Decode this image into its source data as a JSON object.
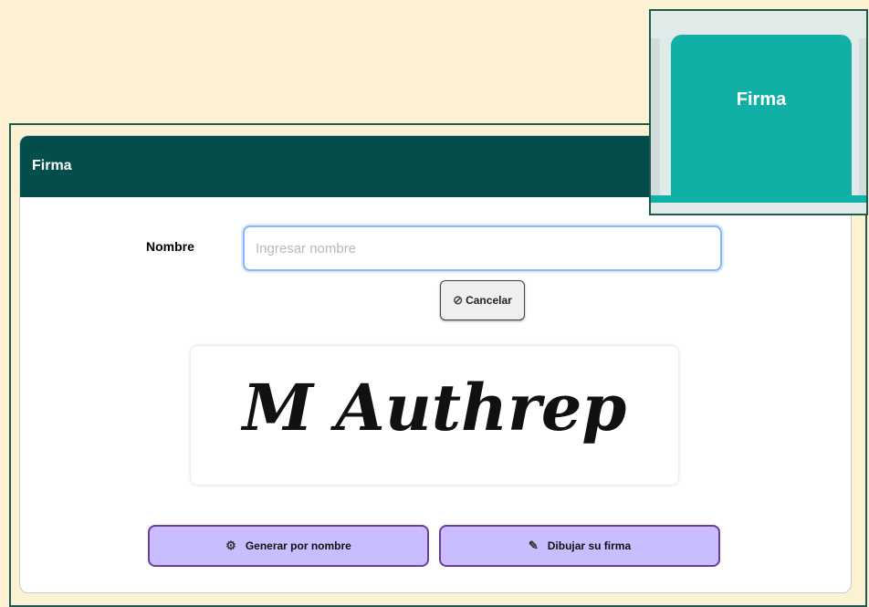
{
  "dialog": {
    "title": "Firma"
  },
  "form": {
    "name_label": "Nombre",
    "name_placeholder": "Ingresar nombre",
    "name_value": ""
  },
  "buttons": {
    "cancel_label": "Cancelar",
    "generate_label": "Generar por nombre",
    "draw_label": "Dibujar su firma"
  },
  "signature": {
    "text": "M Authrep"
  },
  "tab": {
    "label": "Firma",
    "color": "#10b0a6"
  },
  "icons": {
    "cancel": "ban-icon",
    "generate": "gears-icon",
    "draw": "pencil-icon"
  },
  "colors": {
    "header_bg": "#034d4b",
    "page_bg": "#fdf1d4",
    "button_bg": "#c9bcff",
    "button_border": "#6a3d98"
  }
}
